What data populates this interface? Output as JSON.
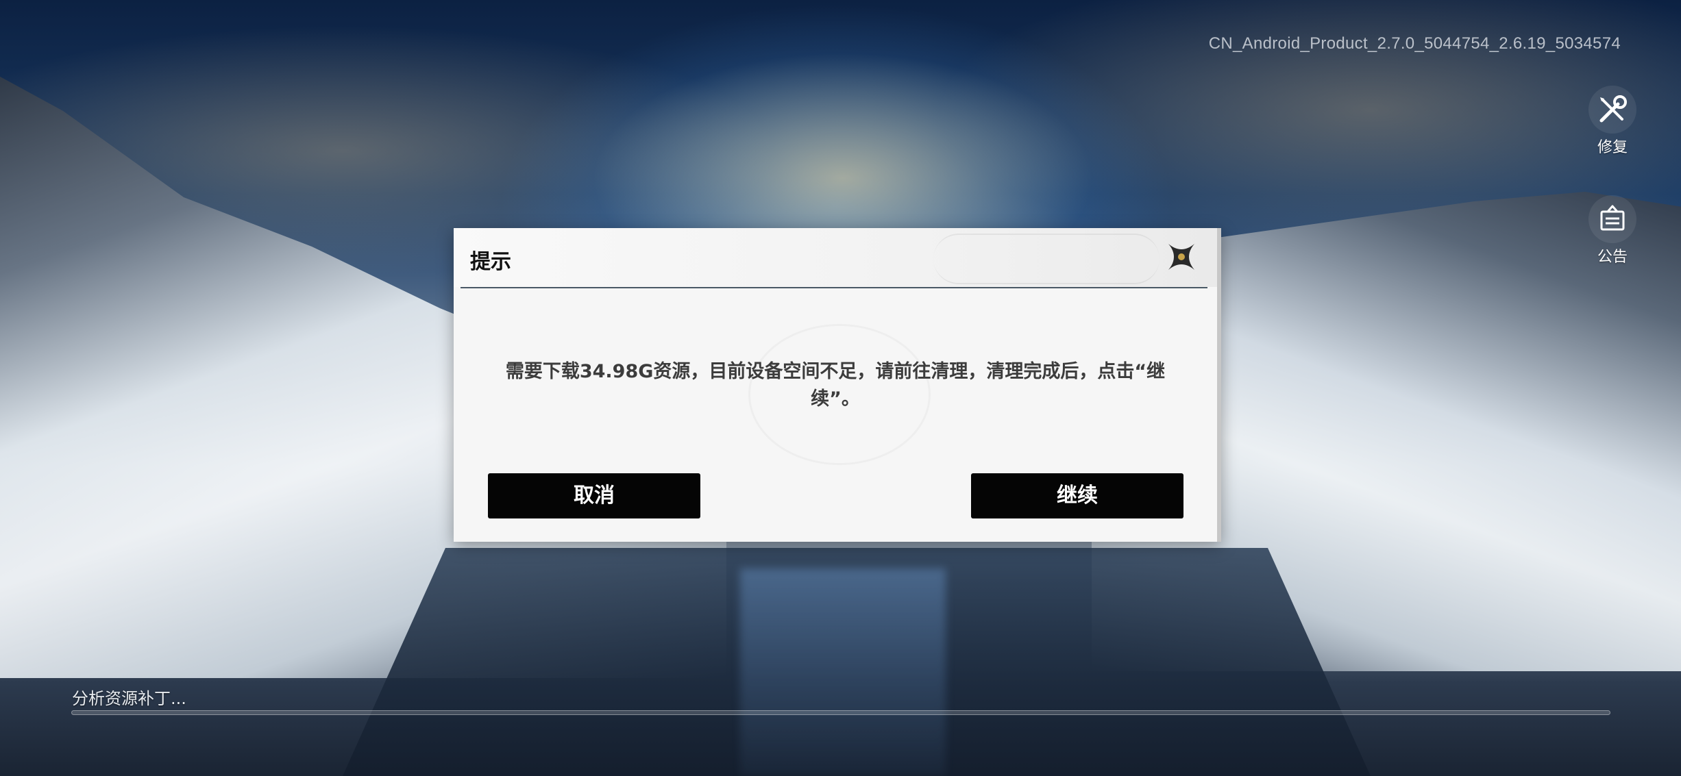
{
  "version_label": "CN_Android_Product_2.7.0_5044754_2.6.19_5034574",
  "side_buttons": {
    "repair": {
      "label": "修复",
      "icon": "wrench-screwdriver-icon"
    },
    "notice": {
      "label": "公告",
      "icon": "notice-board-icon"
    }
  },
  "dialog": {
    "title": "提示",
    "message": "需要下载34.98G资源，目前设备空间不足，请前往清理，清理完成后，点击“继续”。",
    "cancel_label": "取消",
    "continue_label": "继续",
    "close_icon": "close-x-icon"
  },
  "status": {
    "text": "分析资源补丁...",
    "progress_percent": 0
  },
  "colors": {
    "button_bg": "#050505",
    "dialog_bg": "#f6f6f6",
    "header_line": "#4a5966"
  }
}
